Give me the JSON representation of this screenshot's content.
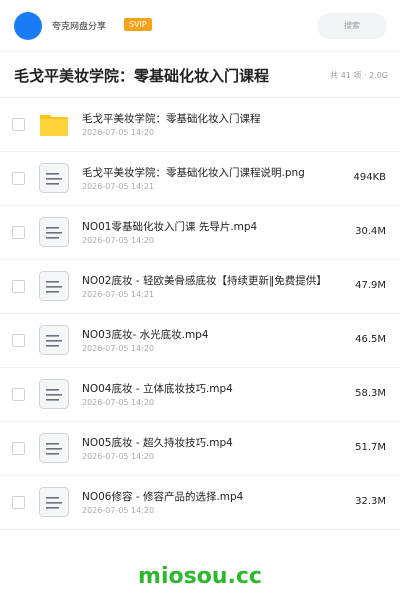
{
  "header": {
    "brand": "夸克网盘分享",
    "badge": "SVIP",
    "search_placeholder": "搜索"
  },
  "page": {
    "title": "毛戈平美妆学院：零基础化妆入门课程",
    "meta": "共 41 项 · 2.0G"
  },
  "files": [
    {
      "name": "毛戈平美妆学院：零基础化妆入门课程",
      "date": "2026-07-05 14:20",
      "size": "",
      "type": "folder"
    },
    {
      "name": "毛戈平美妆学院：零基础化妆入门课程说明.png",
      "date": "2026-07-05 14:21",
      "size": "494KB",
      "type": "file"
    },
    {
      "name": "NO01零基础化妆入门课 先导片.mp4",
      "date": "2026-07-05 14:20",
      "size": "30.4M",
      "type": "file"
    },
    {
      "name": "NO02底妆 - 轻欧美骨感底妆【持续更新‖免费提供】",
      "date": "2026-07-05 14:21",
      "size": "47.9M",
      "type": "file"
    },
    {
      "name": "NO03底妆- 水光底妆.mp4",
      "date": "2026-07-05 14:20",
      "size": "46.5M",
      "type": "file"
    },
    {
      "name": "NO04底妆 - 立体底妆技巧.mp4",
      "date": "2026-07-05 14:20",
      "size": "58.3M",
      "type": "file"
    },
    {
      "name": "NO05底妆 - 超久持妆技巧.mp4",
      "date": "2026-07-05 14:20",
      "size": "51.7M",
      "type": "file"
    },
    {
      "name": "NO06修容 - 修容产品的选择.mp4",
      "date": "2026-07-05 14:20",
      "size": "32.3M",
      "type": "file"
    }
  ],
  "watermark": "miosou.cc",
  "colors": {
    "avatar": "#1a7cf5",
    "svip": "#f7a21b",
    "folder": "#fcc419",
    "watermark": "#2eb82e"
  }
}
